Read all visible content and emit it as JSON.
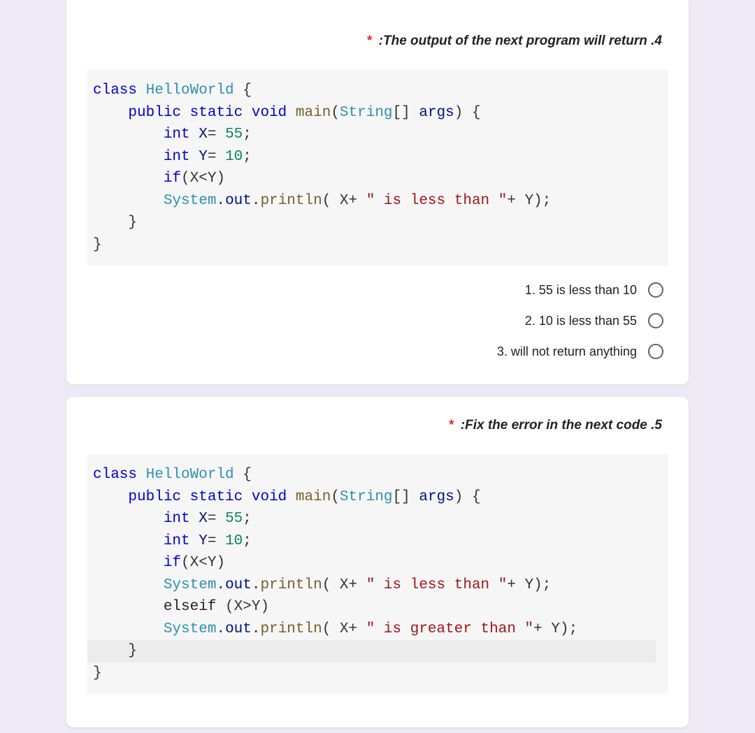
{
  "q4": {
    "prompt": ":The output of the next program will return .4",
    "code": {
      "l1_class": "class",
      "l1_name": "HelloWorld",
      "l1_brace": " {",
      "l2_mods": "public static",
      "l2_void": "void",
      "l2_main": "main",
      "l2_sig_a": "(",
      "l2_string": "String",
      "l2_sig_b": "[] ",
      "l2_args": "args",
      "l2_sig_c": ") {",
      "l3_int": "int",
      "l3_x": " X",
      "l3_eq": "= ",
      "l3_55": "55",
      "l3_semi": ";",
      "l4_int": "int",
      "l4_y": " Y",
      "l4_eq": "= ",
      "l4_10": "10",
      "l4_semi": ";",
      "l5_if": "if",
      "l5_cond": "(X<Y)",
      "l6_sys": "System",
      "l6_dot1": ".",
      "l6_out": "out",
      "l6_dot2": ".",
      "l6_println": "println",
      "l6_a": "( X+ ",
      "l6_str": "\" is less than \"",
      "l6_b": "+ Y);",
      "l7_brace": "}",
      "l8_brace": "}"
    },
    "options": [
      "1. 55 is less than 10",
      "2. 10 is less than 55",
      "3. will not return anything"
    ]
  },
  "q5": {
    "prompt": ":Fix the error in the next code .5",
    "code": {
      "l1_class": "class",
      "l1_name": "HelloWorld",
      "l1_brace": " {",
      "l2_mods": "public static",
      "l2_void": "void",
      "l2_main": "main",
      "l2_sig_a": "(",
      "l2_string": "String",
      "l2_sig_b": "[] ",
      "l2_args": "args",
      "l2_sig_c": ") {",
      "l3_int": "int",
      "l3_x": " X",
      "l3_eq": "= ",
      "l3_55": "55",
      "l3_semi": ";",
      "l4_int": "int",
      "l4_y": " Y",
      "l4_eq": "= ",
      "l4_10": "10",
      "l4_semi": ";",
      "l5_if": "if",
      "l5_cond": "(X<Y)",
      "l6_sys": "System",
      "l6_dot1": ".",
      "l6_out": "out",
      "l6_dot2": ".",
      "l6_println": "println",
      "l6_a": "( X+ ",
      "l6_str": "\" is less than \"",
      "l6_b": "+ Y);",
      "l7_elseif": "elseif",
      "l7_cond": " (X>Y)",
      "l8_sys": "System",
      "l8_dot1": ".",
      "l8_out": "out",
      "l8_dot2": ".",
      "l8_println": "println",
      "l8_a": "( X+ ",
      "l8_str": "\" is greater than \"",
      "l8_b": "+ Y);",
      "l9_brace": "}",
      "l10_brace": "}"
    }
  }
}
